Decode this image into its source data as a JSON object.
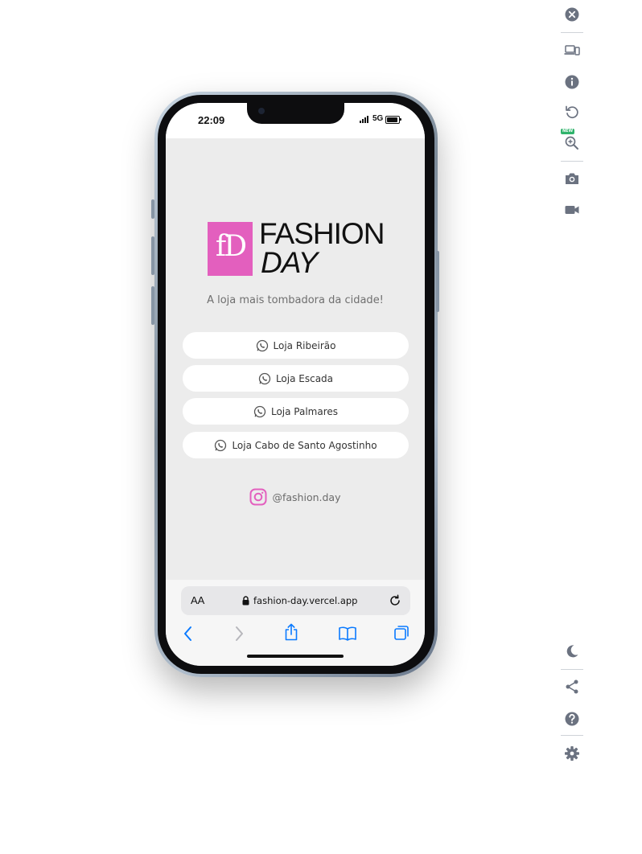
{
  "status_bar": {
    "time": "22:09",
    "network": "5G"
  },
  "brand": {
    "monogram": "fD",
    "line1": "FASHION",
    "line2": "DAY",
    "color": "#e35fbe"
  },
  "tagline": "A loja mais tombadora da cidade!",
  "stores": [
    {
      "label": "Loja Ribeirão",
      "icon": "whatsapp-icon"
    },
    {
      "label": "Loja Escada",
      "icon": "whatsapp-icon"
    },
    {
      "label": "Loja Palmares",
      "icon": "whatsapp-icon"
    },
    {
      "label": "Loja Cabo de Santo Agostinho",
      "icon": "whatsapp-icon"
    }
  ],
  "instagram": {
    "handle": "@fashion.day",
    "icon": "instagram-icon"
  },
  "browser": {
    "text_size_label": "AA",
    "url": "fashion-day.vercel.app",
    "toolbar_icons": [
      "back-icon",
      "forward-icon",
      "share-icon",
      "bookmarks-icon",
      "tabs-icon"
    ]
  },
  "sidebar": {
    "top_icons": [
      "close-icon",
      "devices-icon",
      "info-icon",
      "rotate-icon",
      "zoom-icon",
      "screenshot-icon",
      "record-video-icon"
    ],
    "zoom_badge": "NEW",
    "bottom_icons": [
      "dark-mode-icon",
      "share-icon",
      "help-icon",
      "settings-icon"
    ]
  },
  "colors": {
    "screen_bg": "#ececec",
    "accent_pink": "#e35fbe",
    "ios_blue": "#0a7aff",
    "sidebar_icon": "#6b7280"
  }
}
